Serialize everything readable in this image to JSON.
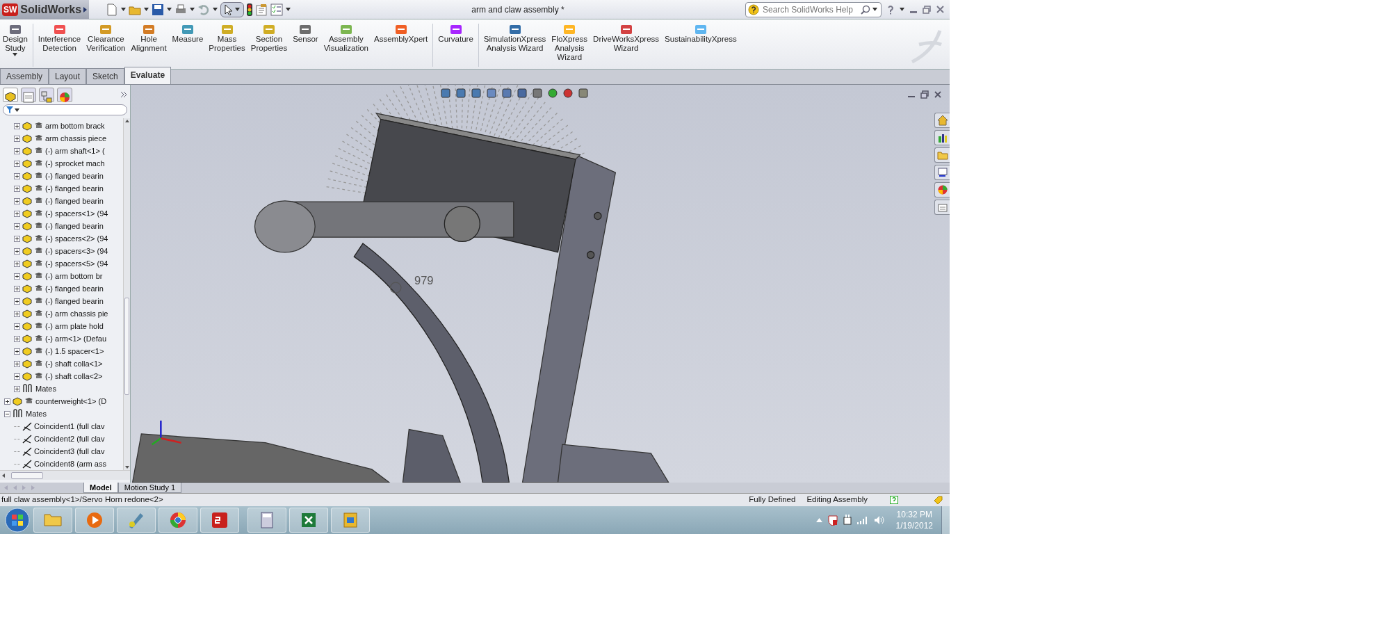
{
  "title_bar": {
    "logo_badge": "SW",
    "app_name": "SolidWorks",
    "document_title": "arm and claw assembly *",
    "search": {
      "placeholder": "Search SolidWorks Help"
    }
  },
  "ribbon": {
    "commands": [
      {
        "lines": [
          "Design",
          "Study"
        ],
        "dropdown": true
      },
      {
        "lines": [
          "Interference",
          "Detection"
        ]
      },
      {
        "lines": [
          "Clearance",
          "Verification"
        ]
      },
      {
        "lines": [
          "Hole",
          "Alignment"
        ]
      },
      {
        "lines": [
          "Measure"
        ]
      },
      {
        "lines": [
          "Mass",
          "Properties"
        ]
      },
      {
        "lines": [
          "Section",
          "Properties"
        ]
      },
      {
        "lines": [
          "Sensor"
        ]
      },
      {
        "lines": [
          "Assembly",
          "Visualization"
        ]
      },
      {
        "lines": [
          "AssemblyXpert"
        ]
      },
      {
        "lines": [
          "Curvature"
        ]
      },
      {
        "lines": [
          "SimulationXpress",
          "Analysis Wizard"
        ]
      },
      {
        "lines": [
          "FloXpress",
          "Analysis",
          "Wizard"
        ]
      },
      {
        "lines": [
          "DriveWorksXpress",
          "Wizard"
        ]
      },
      {
        "lines": [
          "SustainabilityXpress"
        ]
      }
    ]
  },
  "panel_tabs": [
    {
      "selected": true
    },
    {
      "selected": false
    },
    {
      "selected": false
    },
    {
      "selected": false
    }
  ],
  "tabs": [
    {
      "label": "Assembly",
      "selected": false
    },
    {
      "label": "Layout",
      "selected": false
    },
    {
      "label": "Sketch",
      "selected": false
    },
    {
      "label": "Evaluate",
      "selected": true
    }
  ],
  "tree": [
    {
      "children": [
        {
          "label": "arm bottom brack",
          "kind": "part",
          "expanded": false
        },
        {
          "label": "arm chassis piece",
          "kind": "part",
          "expanded": false
        },
        {
          "label": "(-) arm shaft<1> (",
          "kind": "part",
          "expanded": false
        },
        {
          "label": "(-) sprocket mach",
          "kind": "part",
          "expanded": false
        },
        {
          "label": "(-) flanged bearin",
          "kind": "part",
          "expanded": false
        },
        {
          "label": "(-) flanged bearin",
          "kind": "part",
          "expanded": false
        },
        {
          "label": "(-) flanged bearin",
          "kind": "part",
          "expanded": false
        },
        {
          "label": "(-) spacers<1> (94",
          "kind": "part",
          "expanded": false
        },
        {
          "label": "(-) flanged bearin",
          "kind": "part",
          "expanded": false
        },
        {
          "label": "(-) spacers<2> (94",
          "kind": "part",
          "expanded": false
        },
        {
          "label": "(-) spacers<3> (94",
          "kind": "part",
          "expanded": false
        },
        {
          "label": "(-) spacers<5> (94",
          "kind": "part",
          "expanded": false
        },
        {
          "label": "(-) arm bottom br",
          "kind": "part",
          "expanded": false
        },
        {
          "label": "(-) flanged bearin",
          "kind": "part",
          "expanded": false
        },
        {
          "label": "(-) flanged bearin",
          "kind": "part",
          "expanded": false
        },
        {
          "label": "(-) arm chassis pie",
          "kind": "part",
          "expanded": false
        },
        {
          "label": "(-) arm plate hold",
          "kind": "part",
          "expanded": false
        },
        {
          "label": "(-) arm<1> (Defau",
          "kind": "part",
          "expanded": false
        },
        {
          "label": "(-) 1.5 spacer<1>",
          "kind": "part",
          "expanded": false
        },
        {
          "label": "(-) shaft colla<1>",
          "kind": "part",
          "expanded": false
        },
        {
          "label": "(-) shaft colla<2>",
          "kind": "part",
          "expanded": false
        },
        {
          "label": "Mates",
          "kind": "mates",
          "expanded": false
        }
      ]
    },
    {
      "label": "counterweight<1> (D",
      "kind": "part",
      "expanded": false
    },
    {
      "label": "Mates",
      "kind": "mates",
      "expanded": true,
      "children": [
        {
          "label": "Coincident1 (full clav",
          "kind": "mate"
        },
        {
          "label": "Coincident2 (full clav",
          "kind": "mate"
        },
        {
          "label": "Coincident3 (full clav",
          "kind": "mate"
        },
        {
          "label": "Coincident8 (arm ass",
          "kind": "mate"
        }
      ]
    }
  ],
  "viewport": {
    "dimension": "979"
  },
  "bottom_tabs": [
    {
      "label": "Model",
      "selected": true
    },
    {
      "label": "Motion Study 1",
      "selected": false
    }
  ],
  "status_bar": {
    "path": "full claw assembly<1>/Servo Horn redone<2>",
    "state": "Fully Defined",
    "mode": "Editing Assembly"
  },
  "taskbar": {
    "time": "10:32 PM",
    "date": "1/19/2012"
  }
}
